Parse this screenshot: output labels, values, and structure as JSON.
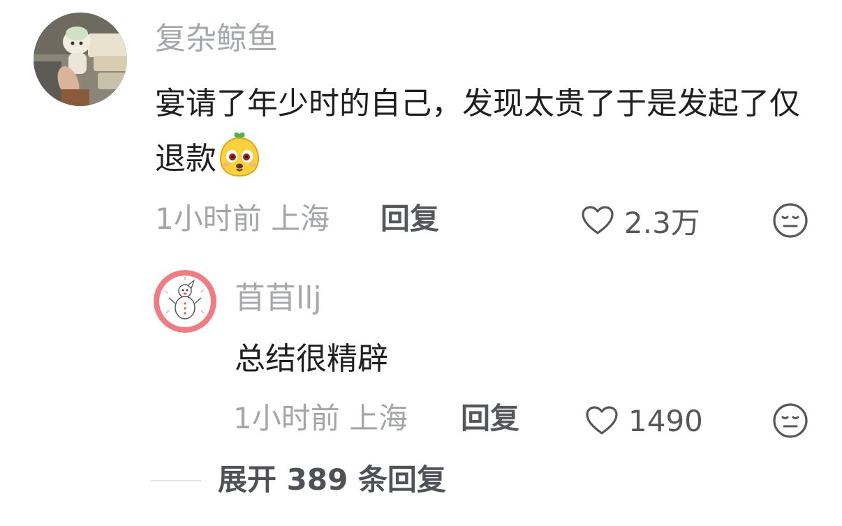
{
  "main_comment": {
    "username": "复杂鲸鱼",
    "text": "宴请了年少时的自己，发现太贵了于是发起了仅退款",
    "time_location": "1小时前 上海",
    "reply_label": "回复",
    "like_count": "2.3万",
    "avatar_icon": "avatar-photo-plush-toy",
    "emoji_icon": "emoji-yellow-face"
  },
  "reply_comment": {
    "username": "苜苜llj",
    "text": "总结很精辟",
    "time_location": "1小时前 上海",
    "reply_label": "回复",
    "like_count": "1490",
    "avatar_icon": "avatar-snowman-cartoon"
  },
  "expand": {
    "label": "展开 389 条回复"
  },
  "icons": {
    "like": "heart-outline-icon",
    "dislike": "meh-face-icon"
  },
  "colors": {
    "username": "#a6a8ad",
    "body_text": "#1f1f1f",
    "meta": "#a3a5aa",
    "action": "#55575c"
  }
}
